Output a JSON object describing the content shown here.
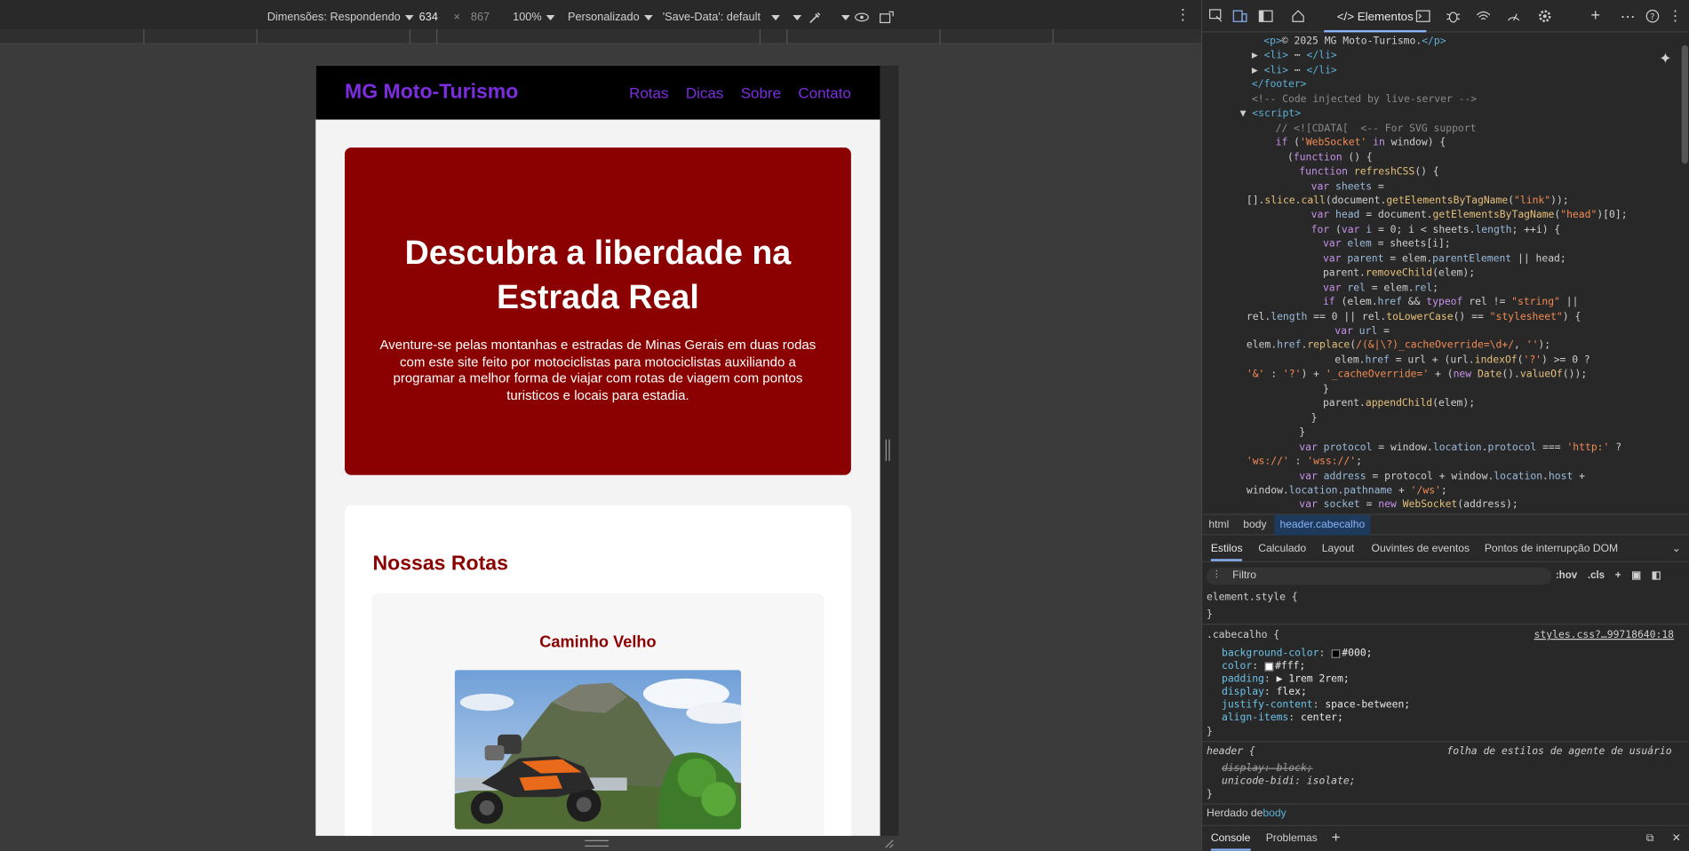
{
  "device_toolbar": {
    "dimensions_label": "Dimensões: Respondendo",
    "width_value": "634",
    "times": "×",
    "height_value": "867",
    "zoom": "100%",
    "throttle": "Personalizado",
    "save_data": "'Save-Data': default"
  },
  "site": {
    "logo": "MG Moto-Turismo",
    "nav": [
      "Rotas",
      "Dicas",
      "Sobre",
      "Contato"
    ],
    "hero_title": "Descubra a liberdade na Estrada Real",
    "hero_text": "Aventure-se pelas montanhas e estradas de Minas Gerais em duas rodas com este site feito por motociclistas para motociclistas auxiliando a programar a melhor forma de viajar com rotas de viagem com pontos turisticos e locais para estadia.",
    "section_title": "Nossas Rotas",
    "card_title": "Caminho Velho"
  },
  "devtools": {
    "elements_tab": "Elementos",
    "dom_lines": [
      {
        "indent": 3,
        "html": "<span class='t'>&lt;p&gt;</span>© 2025 MG Moto-Turismo.<span class='t'>&lt;/p&gt;</span>"
      },
      {
        "indent": 2,
        "html": "▶ <span class='t'>&lt;li&gt;</span> ⋯ <span class='t'>&lt;/li&gt;</span>"
      },
      {
        "indent": 2,
        "html": "▶ <span class='t'>&lt;li&gt;</span> ⋯ <span class='t'>&lt;/li&gt;</span>"
      },
      {
        "indent": 2,
        "html": "<span class='t'>&lt;/footer&gt;</span>"
      },
      {
        "indent": 2,
        "html": "<span class='c'>&lt;!-- Code injected by live-server --&gt;</span>"
      },
      {
        "indent": 1,
        "html": "▼ <span class='t'>&lt;script&gt;</span>"
      },
      {
        "indent": 4,
        "html": "<span class='c'>// &lt;![CDATA[  &lt;-- For SVG support</span>"
      },
      {
        "indent": 4,
        "html": "<span class='k'>if</span> (<span class='s'>'WebSocket'</span> <span class='k'>in</span> window) {"
      },
      {
        "indent": 5,
        "html": "(<span class='k'>function</span> () {"
      },
      {
        "indent": 6,
        "html": "<span class='k'>function</span> <span class='f'>refreshCSS</span>() {"
      },
      {
        "indent": 7,
        "html": "<span class='k'>var</span> <span class='v'>sheets</span> ="
      },
      {
        "indent": 0,
        "html": "[].<span class='f'>slice</span>.<span class='f'>call</span>(document.<span class='f'>getElementsByTagName</span>(<span class='s'>\"link\"</span>));"
      },
      {
        "indent": 7,
        "html": "<span class='k'>var</span> <span class='v'>head</span> = document.<span class='f'>getElementsByTagName</span>(<span class='s'>\"head\"</span>)[0];"
      },
      {
        "indent": 7,
        "html": "<span class='k'>for</span> (<span class='k'>var</span> <span class='v'>i</span> = 0; i &lt; sheets.<span class='v'>length</span>; ++i) {"
      },
      {
        "indent": 8,
        "html": "<span class='k'>var</span> <span class='v'>elem</span> = sheets[i];"
      },
      {
        "indent": 8,
        "html": "<span class='k'>var</span> <span class='v'>parent</span> = elem.<span class='v'>parentElement</span> || head;"
      },
      {
        "indent": 8,
        "html": "parent.<span class='f'>removeChild</span>(elem);"
      },
      {
        "indent": 8,
        "html": "<span class='k'>var</span> <span class='v'>rel</span> = elem.<span class='v'>rel</span>;"
      },
      {
        "indent": 8,
        "html": "<span class='k'>if</span> (elem.<span class='v'>href</span> &amp;&amp; <span class='k'>typeof</span> rel != <span class='s'>\"string\"</span> ||"
      },
      {
        "indent": 0,
        "html": "rel.<span class='v'>length</span> == 0 || rel.<span class='f'>toLowerCase</span>() == <span class='s'>\"stylesheet\"</span>) {"
      },
      {
        "indent": 9,
        "html": "<span class='k'>var</span> <span class='v'>url</span> ="
      },
      {
        "indent": 0,
        "html": "elem.<span class='v'>href</span>.<span class='f'>replace</span>(<span class='s'>/(&amp;|\\?)_cacheOverride=\\d+/</span>, <span class='s'>''</span>);"
      },
      {
        "indent": 9,
        "html": "elem.<span class='v'>href</span> = url + (url.<span class='f'>indexOf</span>(<span class='s'>'?'</span>) &gt;= 0 ?"
      },
      {
        "indent": 0,
        "html": "<span class='s'>'&amp;'</span> : <span class='s'>'?'</span>) + <span class='s'>'_cacheOverride='</span> + (<span class='k'>new</span> <span class='f'>Date</span>().<span class='f'>valueOf</span>());"
      },
      {
        "indent": 8,
        "html": "}"
      },
      {
        "indent": 8,
        "html": "parent.<span class='f'>appendChild</span>(elem);"
      },
      {
        "indent": 7,
        "html": "}"
      },
      {
        "indent": 6,
        "html": "}"
      },
      {
        "indent": 6,
        "html": "<span class='k'>var</span> <span class='v'>protocol</span> = window.<span class='v'>location</span>.<span class='v'>protocol</span> === <span class='s'>'http:'</span> ?"
      },
      {
        "indent": 0,
        "html": "<span class='s'>'ws://'</span> : <span class='s'>'wss://'</span>;"
      },
      {
        "indent": 6,
        "html": "<span class='k'>var</span> <span class='v'>address</span> = protocol + window.<span class='v'>location</span>.<span class='v'>host</span> +"
      },
      {
        "indent": 0,
        "html": "window.<span class='v'>location</span>.<span class='v'>pathname</span> + <span class='s'>'/ws'</span>;"
      },
      {
        "indent": 6,
        "html": "<span class='k'>var</span> <span class='v'>socket</span> = <span class='k'>new</span> <span class='f'>WebSocket</span>(address);"
      }
    ],
    "breadcrumbs": [
      "html",
      "body",
      "header.cabecalho"
    ],
    "style_tabs": [
      "Estilos",
      "Calculado",
      "Layout",
      "Ouvintes de eventos",
      "Pontos de interrupção DOM"
    ],
    "filter_placeholder": "Filtro",
    "hov": ":hov",
    "cls": ".cls",
    "element_style": "element.style {",
    "close_brace": "}",
    "rule_selector": ".cabecalho {",
    "rule_source": "styles.css?…99718640:18",
    "rule_props": [
      {
        "name": "background-color",
        "value": "#000;",
        "swatch": "#000"
      },
      {
        "name": "color",
        "value": "#fff;",
        "swatch": "#fff"
      },
      {
        "name": "padding",
        "value": "▶ 1rem 2rem;",
        "swatch": ""
      },
      {
        "name": "display",
        "value": "flex;",
        "swatch": ""
      },
      {
        "name": "justify-content",
        "value": "space-between;",
        "swatch": ""
      },
      {
        "name": "align-items",
        "value": "center;",
        "swatch": ""
      }
    ],
    "ua_selector": "header {",
    "ua_source": "folha de estilos de agente de usuário",
    "ua_props": [
      "display: block;",
      "unicode-bidi: isolate;"
    ],
    "inherited_label": "Herdado de",
    "inherited_from": "body",
    "console_tabs": [
      "Console",
      "Problemas"
    ]
  }
}
